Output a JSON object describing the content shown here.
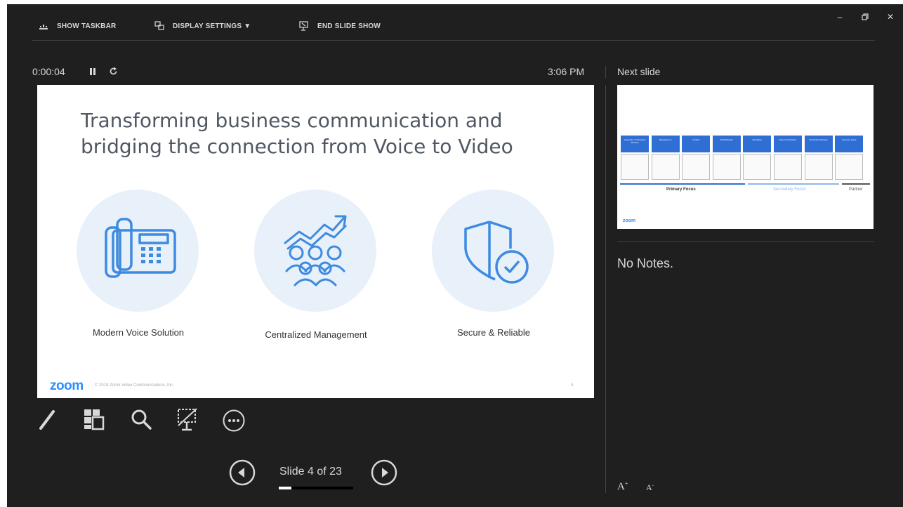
{
  "toolbar": {
    "show_taskbar": "SHOW TASKBAR",
    "display_settings": "DISPLAY SETTINGS ▼",
    "end_slide_show": "END SLIDE SHOW"
  },
  "window_controls": [
    "minimize-icon",
    "restore-icon",
    "close-icon"
  ],
  "presenter": {
    "timer": "0:00:04",
    "clock": "3:06 PM"
  },
  "slide": {
    "title": "Transforming business communication and bridging the connection from Voice to Video",
    "features": [
      {
        "label": "Modern Voice Solution",
        "icon": "desk-phone-icon"
      },
      {
        "label": "Centralized Management",
        "icon": "growth-team-icon"
      },
      {
        "label": "Secure & Reliable",
        "icon": "shield-check-icon"
      }
    ],
    "logo": "zoom",
    "copyright": "© 2019 Zoom Video Communications, Inc.",
    "page_number": "4"
  },
  "tools": [
    "pen-icon",
    "see-all-slides-icon",
    "zoom-magnifier-icon",
    "black-screen-icon",
    "more-options-icon"
  ],
  "navigation": {
    "slide_label": "Slide 4 of 23",
    "progress_fraction": 0.174
  },
  "next_slide": {
    "label": "Next slide",
    "thumbnail": {
      "headers": [
        "Corporate / Information Workers",
        "Management",
        "Lobbies",
        "Field Workers",
        "Reception",
        "Task Line Workers",
        "Production Workers",
        "Common Areas"
      ],
      "primary_focus": "Primary Focus",
      "secondary_focus": "Secondary Focus",
      "partner": "Partner",
      "logo": "zoom"
    }
  },
  "notes": {
    "text": "No Notes."
  },
  "font_controls": [
    "increase-font-icon",
    "decrease-font-icon"
  ],
  "colors": {
    "background": "#1f1f1f",
    "accent_blue": "#2f6fd3",
    "icon_blue": "#3d8be0",
    "circle_bg": "#e8f0fa",
    "zoom_blue": "#2d8cff"
  }
}
